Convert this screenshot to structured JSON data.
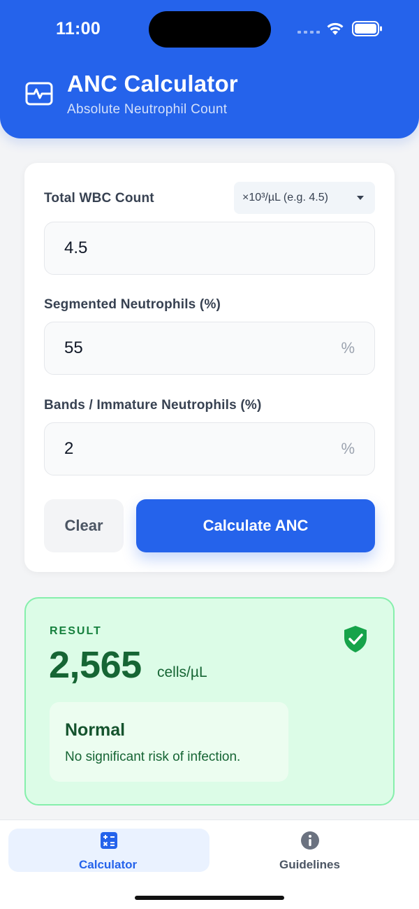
{
  "status_bar": {
    "time": "11:00"
  },
  "header": {
    "title": "ANC Calculator",
    "subtitle": "Absolute Neutrophil Count",
    "icon": "activity-monitor-icon"
  },
  "form": {
    "wbc": {
      "label": "Total WBC Count",
      "unit_selected": "×10³/µL (e.g. 4.5)",
      "value": "4.5"
    },
    "segmented": {
      "label": "Segmented Neutrophils (%)",
      "value": "55",
      "suffix": "%"
    },
    "bands": {
      "label": "Bands / Immature Neutrophils (%)",
      "value": "2",
      "suffix": "%"
    },
    "clear_label": "Clear",
    "calculate_label": "Calculate ANC"
  },
  "result": {
    "label": "RESULT",
    "value": "2,565",
    "unit": "cells/µL",
    "status_title": "Normal",
    "status_description": "No significant risk of infection.",
    "icon": "shield-check-icon"
  },
  "tabs": [
    {
      "label": "Calculator",
      "icon": "calculator-icon",
      "active": true
    },
    {
      "label": "Guidelines",
      "icon": "info-icon",
      "active": false
    }
  ],
  "colors": {
    "primary": "#2563eb",
    "success": "#16a34a",
    "success_bg": "#dcfce7"
  }
}
